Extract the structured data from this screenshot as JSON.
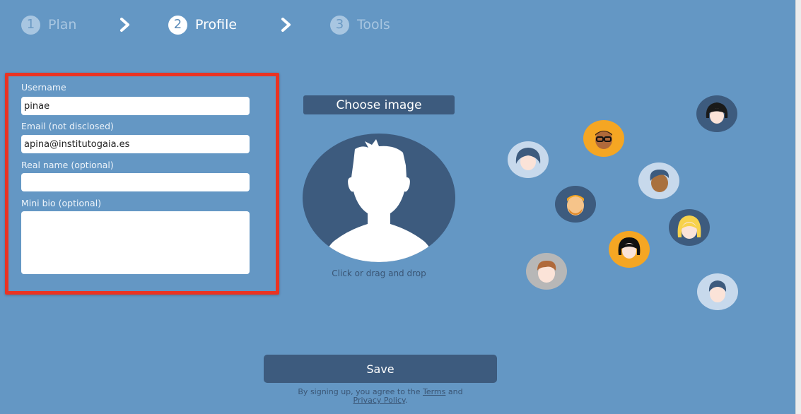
{
  "colors": {
    "background": "#6497c4",
    "button": "#3d5b7e",
    "highlight": "#ea3323",
    "step_inactive": "#a8c6e1"
  },
  "steps": [
    {
      "number": "1",
      "label": "Plan",
      "state": "inactive"
    },
    {
      "number": "2",
      "label": "Profile",
      "state": "active"
    },
    {
      "number": "3",
      "label": "Tools",
      "state": "inactive"
    }
  ],
  "form": {
    "username_label": "Username",
    "username_value": "pinae",
    "email_label": "Email (not disclosed)",
    "email_value": "apina@institutogaia.es",
    "realname_label": "Real name (optional)",
    "realname_value": "",
    "bio_label": "Mini bio (optional)",
    "bio_value": ""
  },
  "image_upload": {
    "button_label": "Choose image",
    "hint": "Click or drag and drop",
    "icon": "user-silhouette-icon"
  },
  "save_label": "Save",
  "terms": {
    "prefix": "By signing up, you agree to the",
    "terms_link": "Terms",
    "and": "and",
    "privacy_link": "Privacy Policy",
    "suffix": "."
  }
}
